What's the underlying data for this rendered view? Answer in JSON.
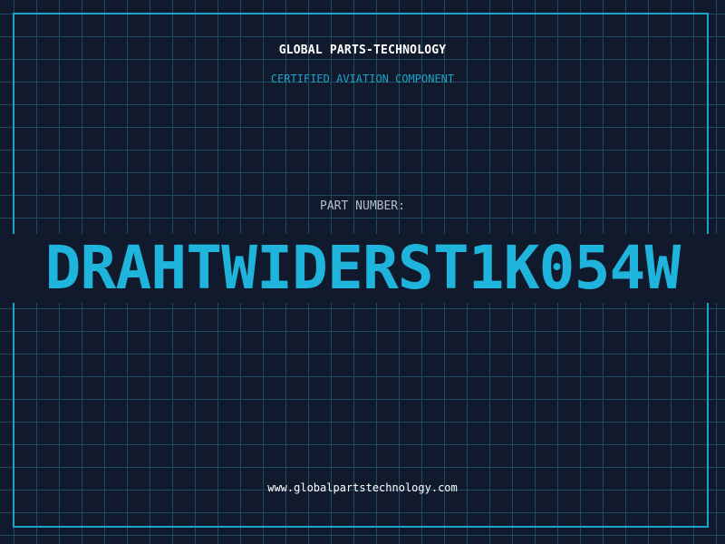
{
  "header": {
    "company_name": "GLOBAL PARTS-TECHNOLOGY",
    "tagline": "CERTIFIED AVIATION COMPONENT"
  },
  "part": {
    "label": "PART NUMBER:",
    "number": "DRAHTWIDERST1K054W"
  },
  "footer": {
    "website": "www.globalpartstechnology.com"
  },
  "colors": {
    "background": "#111a2c",
    "grid": "#1e4a62",
    "accent": "#1aa4c8",
    "part_number": "#1fb4dc",
    "heading": "#ffffff",
    "label": "#b7bfcc"
  }
}
